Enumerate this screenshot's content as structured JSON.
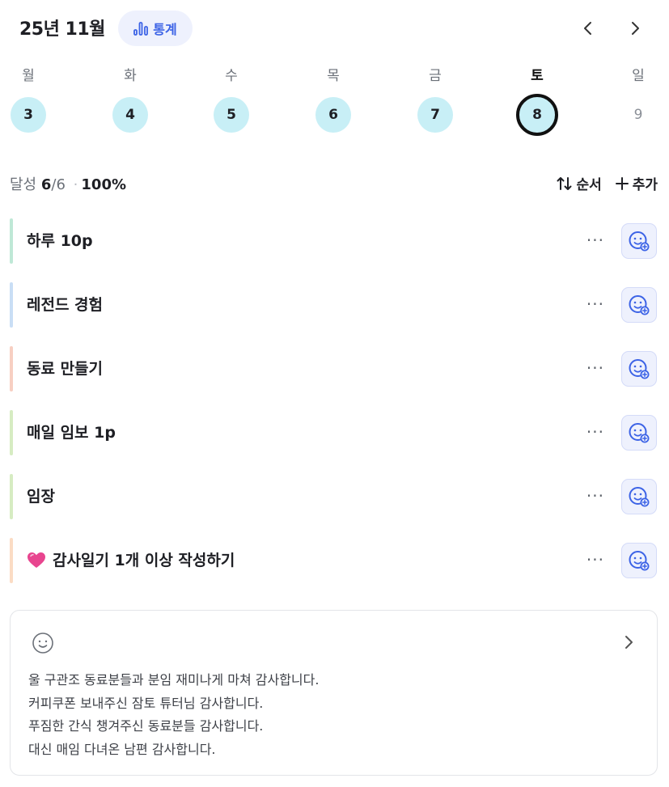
{
  "header": {
    "month": "25년 11월",
    "stats_label": "통계"
  },
  "week": {
    "days": [
      {
        "name": "월",
        "num": "3",
        "state": "done"
      },
      {
        "name": "화",
        "num": "4",
        "state": "done"
      },
      {
        "name": "수",
        "num": "5",
        "state": "done"
      },
      {
        "name": "목",
        "num": "6",
        "state": "done"
      },
      {
        "name": "금",
        "num": "7",
        "state": "done"
      },
      {
        "name": "토",
        "num": "8",
        "state": "selected"
      },
      {
        "name": "일",
        "num": "9",
        "state": "empty"
      }
    ]
  },
  "summary": {
    "label": "달성",
    "done": "6",
    "total": "/6",
    "separator": "·",
    "percent": "100%"
  },
  "actions": {
    "order_label": "순서",
    "add_label": "추가"
  },
  "tasks": [
    {
      "title": "하루 10p",
      "color": "#bfe8d6",
      "emoji": ""
    },
    {
      "title": "레전드 경험",
      "color": "#c9def5",
      "emoji": ""
    },
    {
      "title": "동료 만들기",
      "color": "#f7cfc2",
      "emoji": ""
    },
    {
      "title": "매일 임보 1p",
      "color": "#d6ecc2",
      "emoji": ""
    },
    {
      "title": "임장",
      "color": "#d6ecc2",
      "emoji": ""
    },
    {
      "title": "감사일기 1개 이상 작성하기",
      "color": "#fbdcc4",
      "emoji": "💗"
    }
  ],
  "task_more": "···",
  "journal": {
    "lines": [
      "울 구관조 동료분들과 분임 재미나게 마쳐 감사합니다.",
      "커피쿠폰 보내주신 잠토 튜터님 감사합니다.",
      "푸짐한 간식 챙겨주신 동료분들 감사합니다.",
      "대신 매임 다녀온 남편 감사합니다."
    ]
  },
  "colors": {
    "accent": "#3c63e6",
    "accent_bg": "#eef1fd",
    "day_done": "#c8eff6"
  }
}
